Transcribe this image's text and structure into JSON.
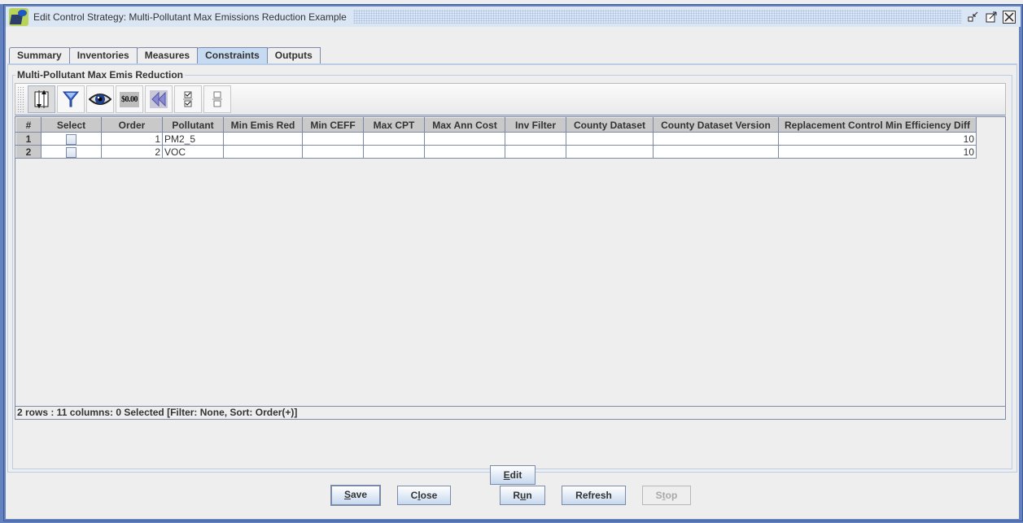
{
  "window": {
    "title": "Edit Control Strategy: Multi-Pollutant Max Emissions Reduction Example",
    "controls": {
      "minimize": "minimize-icon",
      "maximize": "maximize-icon",
      "close": "close-icon"
    }
  },
  "tabs": [
    {
      "label": "Summary",
      "active": false
    },
    {
      "label": "Inventories",
      "active": false
    },
    {
      "label": "Measures",
      "active": false
    },
    {
      "label": "Constraints",
      "active": true
    },
    {
      "label": "Outputs",
      "active": false
    }
  ],
  "panel": {
    "group_title": "Multi-Pollutant Max Emis Reduction",
    "toolbar": [
      {
        "name": "sort-icon"
      },
      {
        "name": "filter-icon"
      },
      {
        "name": "view-icon"
      },
      {
        "name": "format-icon",
        "text": "$0.00"
      },
      {
        "name": "reset-icon"
      },
      {
        "name": "select-all-icon"
      },
      {
        "name": "clear-all-icon"
      }
    ],
    "table": {
      "columns": [
        "#",
        "Select",
        "Order",
        "Pollutant",
        "Min Emis Red",
        "Min CEFF",
        "Max CPT",
        "Max Ann Cost",
        "Inv Filter",
        "County Dataset",
        "County Dataset Version",
        "Replacement Control Min Efficiency Diff"
      ],
      "rows": [
        {
          "num": "1",
          "selected": false,
          "order": "1",
          "pollutant": "PM2_5",
          "min_emis_red": "",
          "min_ceff": "",
          "max_cpt": "",
          "max_ann_cost": "",
          "inv_filter": "",
          "county_dataset": "",
          "county_dataset_version": "",
          "repl_min_eff_diff": "10"
        },
        {
          "num": "2",
          "selected": false,
          "order": "2",
          "pollutant": "VOC",
          "min_emis_red": "",
          "min_ceff": "",
          "max_cpt": "",
          "max_ann_cost": "",
          "inv_filter": "",
          "county_dataset": "",
          "county_dataset_version": "",
          "repl_min_eff_diff": "10"
        }
      ]
    },
    "status": "2 rows : 11 columns: 0 Selected [Filter: None, Sort: Order(+)]",
    "edit_button": {
      "mnemonic": "E",
      "rest": "dit"
    }
  },
  "footer": {
    "save": {
      "mnemonic": "S",
      "rest": "ave"
    },
    "close": {
      "pre": "C",
      "mnemonic": "l",
      "rest": "ose"
    },
    "run": {
      "pre": "R",
      "mnemonic": "u",
      "rest": "n"
    },
    "refresh": {
      "label": "Refresh"
    },
    "stop": {
      "pre": "S",
      "mnemonic": "t",
      "rest": "op",
      "disabled": true
    }
  }
}
